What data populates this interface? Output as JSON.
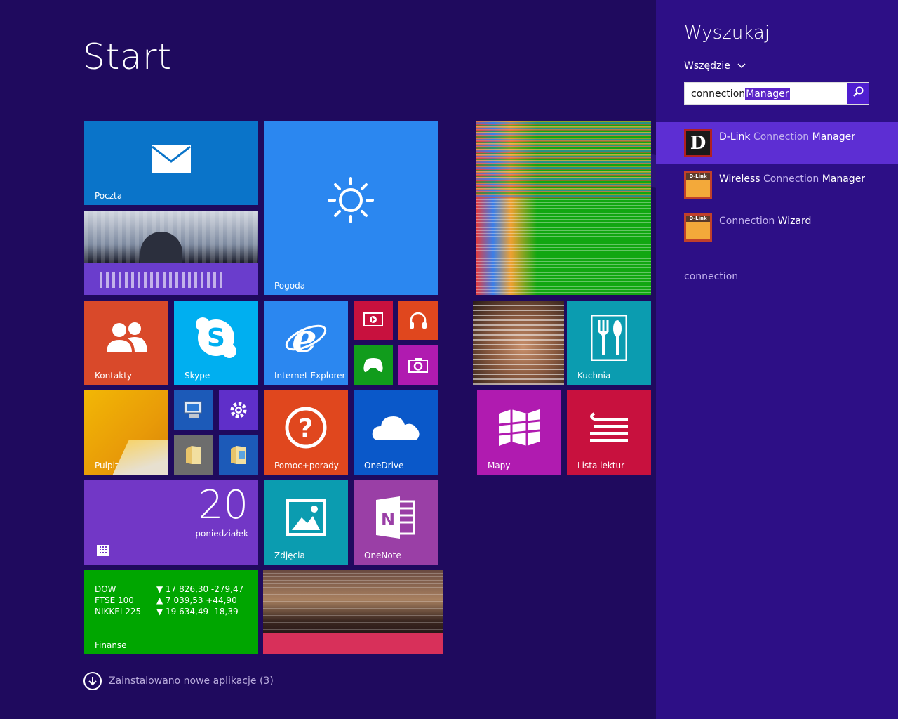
{
  "start": {
    "title": "Start"
  },
  "tiles": {
    "mail": "Poczta",
    "weather": "Pogoda",
    "contacts": "Kontakty",
    "skype": "Skype",
    "ie": "Internet Explorer",
    "kitchen": "Kuchnia",
    "desktop": "Pulpit",
    "help": "Pomoc+porady",
    "onedrive": "OneDrive",
    "maps": "Mapy",
    "reading_list": "Lista lektur",
    "calendar_day": "20",
    "calendar_weekday": "poniedziałek",
    "photos": "Zdjęcia",
    "onenote": "OneNote",
    "finance": "Finanse"
  },
  "finance_rows": [
    {
      "name": "DOW",
      "value": "▼ 17 826,30 -279,47"
    },
    {
      "name": "FTSE 100",
      "value": "▲ 7 039,53 +44,90"
    },
    {
      "name": "NIKKEI 225",
      "value": "▼ 19 634,49 -18,39"
    }
  ],
  "new_apps_label": "Zainstalowano nowe aplikacje (3)",
  "search": {
    "title": "Wyszukaj",
    "scope": "Wszędzie",
    "query_plain": "connection",
    "query_selected": "Manager",
    "results": [
      {
        "pre": "D-Link ",
        "match": "Connection",
        "post": " Manager",
        "icon": "dlink-d-icon"
      },
      {
        "pre": "Wireless ",
        "match": "Connection",
        "post": " Manager",
        "icon": "dlink-icon"
      },
      {
        "pre": "",
        "match": "Connection",
        "post": " Wizard",
        "icon": "dlink-icon"
      }
    ],
    "suggestion": "connection"
  },
  "colors": {
    "background": "#1f0a5e",
    "search_pane": "#2d0f86",
    "selected_result": "#5d2ed3",
    "accent": "#4f1ed0"
  }
}
